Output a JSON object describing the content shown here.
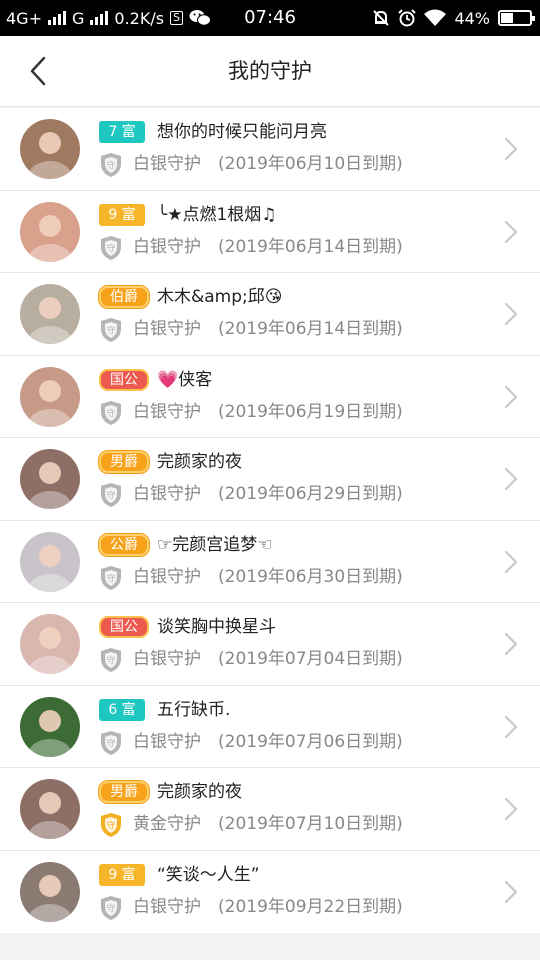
{
  "status_bar": {
    "network": "4G+",
    "signal2": "G",
    "speed": "0.2K/s",
    "sim_icon_text": "S",
    "time": "07:46",
    "battery": "44%",
    "battery_level": 0.44
  },
  "header": {
    "title": "我的守护"
  },
  "guards": [
    {
      "badge": "7 富",
      "badge_style": "teal",
      "name": "想你的时候只能问月亮",
      "guard_type": "白银守护",
      "shield": "silver",
      "expiry": "(2019年06月10日到期)",
      "avatar_color": "#a07a60"
    },
    {
      "badge": "9 富",
      "badge_style": "gold",
      "name": "╰★点燃1根烟♫",
      "guard_type": "白银守护",
      "shield": "silver",
      "expiry": "(2019年06月14日到期)",
      "avatar_color": "#d9a08c"
    },
    {
      "badge": "伯爵",
      "badge_style": "orange",
      "name": "木木&amp;邱😘",
      "guard_type": "白银守护",
      "shield": "silver",
      "expiry": "(2019年06月14日到期)",
      "avatar_color": "#b7ae9f"
    },
    {
      "badge": "国公",
      "badge_style": "red",
      "name": "💗侠客",
      "guard_type": "白银守护",
      "shield": "silver",
      "expiry": "(2019年06月19日到期)",
      "avatar_color": "#c79a88"
    },
    {
      "badge": "男爵",
      "badge_style": "orange",
      "name": "完颜家的夜",
      "guard_type": "白银守护",
      "shield": "silver",
      "expiry": "(2019年06月29日到期)",
      "avatar_color": "#8d6f66"
    },
    {
      "badge": "公爵",
      "badge_style": "orange",
      "name": "☞完颜宫追梦☜",
      "guard_type": "白银守护",
      "shield": "silver",
      "expiry": "(2019年06月30日到期)",
      "avatar_color": "#c8c4c9"
    },
    {
      "badge": "国公",
      "badge_style": "red",
      "name": "谈笑胸中换星斗",
      "guard_type": "白银守护",
      "shield": "silver",
      "expiry": "(2019年07月04日到期)",
      "avatar_color": "#d9b6ae"
    },
    {
      "badge": "6 富",
      "badge_style": "teal",
      "name": "五行缺币.",
      "guard_type": "白银守护",
      "shield": "silver",
      "expiry": "(2019年07月06日到期)",
      "avatar_color": "#3d6b35"
    },
    {
      "badge": "男爵",
      "badge_style": "orange",
      "name": "完颜家的夜",
      "guard_type": "黄金守护",
      "shield": "gold",
      "expiry": "(2019年07月10日到期)",
      "avatar_color": "#8d6f66"
    },
    {
      "badge": "9 富",
      "badge_style": "gold",
      "name": "“笑谈～人生”",
      "guard_type": "白银守护",
      "shield": "silver",
      "expiry": "(2019年09月22日到期)",
      "avatar_color": "#8a7a72"
    }
  ],
  "icons": {
    "back": "chevron-left-icon",
    "row_arrow": "chevron-right-icon",
    "shield": "shield-icon"
  },
  "colors": {
    "teal_badge": "#1ec8c0",
    "gold_badge": "#f7b52a",
    "silver_shield": "#b5b5b5",
    "gold_shield": "#f4b023"
  }
}
